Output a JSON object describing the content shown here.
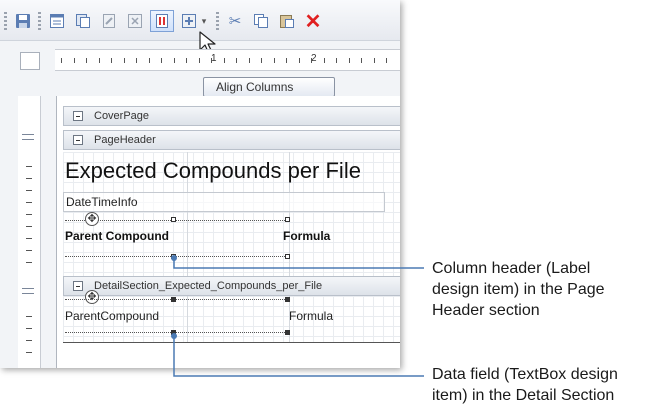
{
  "toolbar": {
    "icons": [
      "save-icon",
      "properties-icon",
      "copy-design-icon",
      "edit-icon",
      "delete-item-icon",
      "align-columns-icon",
      "insert-icon",
      "cut-icon",
      "copy-icon",
      "paste-icon",
      "delete-icon"
    ]
  },
  "tooltip": {
    "text": "Align Columns"
  },
  "ruler": {
    "marks": [
      "1",
      "2"
    ]
  },
  "report": {
    "cover_band": "CoverPage",
    "page_header_band": "PageHeader",
    "title": "Expected Compounds per File",
    "date_time_info": "DateTimeInfo",
    "header_label_parent": "Parent Compound",
    "header_label_formula": "Formula",
    "detail_band": "DetailSection_Expected_Compounds_per_File",
    "field_parent": "ParentCompound",
    "field_formula": "Formula"
  },
  "callouts": {
    "column_header": [
      "Column header (Label",
      "design item) in the Page",
      "Header section"
    ],
    "data_field": [
      "Data field (TextBox design",
      "item) in the Detail Section"
    ]
  },
  "colors": {
    "leader": "#4b7ab3",
    "selection": "#7ea1d6"
  }
}
